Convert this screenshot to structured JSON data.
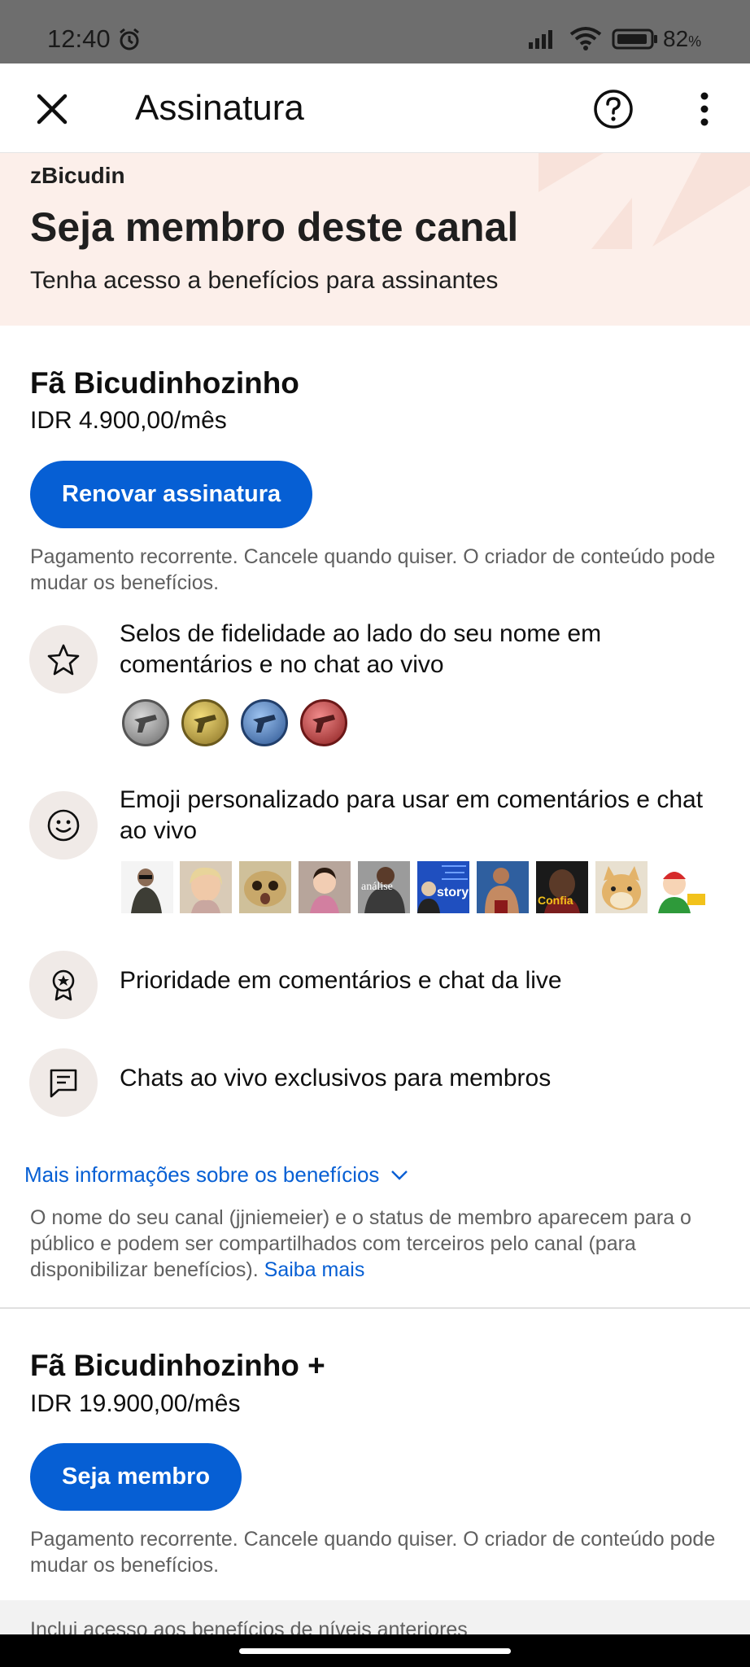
{
  "status_bar": {
    "time": "12:40",
    "battery": "82",
    "battery_unit": "%"
  },
  "app_bar": {
    "title": "Assinatura"
  },
  "banner": {
    "channel": "zBicudin",
    "title": "Seja membro deste canal",
    "subtitle": "Tenha acesso a benefícios para assinantes"
  },
  "tiers": [
    {
      "name": "Fã Bicudinhozinho",
      "price": "IDR 4.900,00/mês",
      "button": "Renovar assinatura",
      "note": "Pagamento recorrente. Cancele quando quiser. O criador de conteúdo pode mudar os benefícios."
    },
    {
      "name": "Fã Bicudinhozinho +",
      "price": "IDR 19.900,00/mês",
      "button": "Seja membro",
      "note": "Pagamento recorrente. Cancele quando quiser. O criador de conteúdo pode mudar os benefícios."
    }
  ],
  "benefits": [
    {
      "icon": "star-icon",
      "text": "Selos de fidelidade ao lado do seu nome em comentários e no chat ao vivo"
    },
    {
      "icon": "smiley-icon",
      "text": "Emoji personalizado para usar em comentários e chat ao vivo"
    },
    {
      "icon": "award-icon",
      "text": "Prioridade em comentários e chat da live"
    },
    {
      "icon": "chat-icon",
      "text": "Chats ao vivo exclusivos para membros"
    }
  ],
  "badge_colors": [
    "#8a8a8a",
    "#c9a63a",
    "#4a78b8",
    "#c23b3b"
  ],
  "emoji_labels": [
    "análise",
    "story",
    "Confia"
  ],
  "more_info": "Mais informações sobre os benefícios",
  "privacy": {
    "text": "O nome do seu canal (jjniemeier) e o status de membro aparecem para o público e podem ser compartilhados com terceiros pelo canal (para disponibilizar benefícios).",
    "link": "Saiba mais"
  },
  "previous_levels": "Inclui acesso aos benefícios de níveis anteriores"
}
